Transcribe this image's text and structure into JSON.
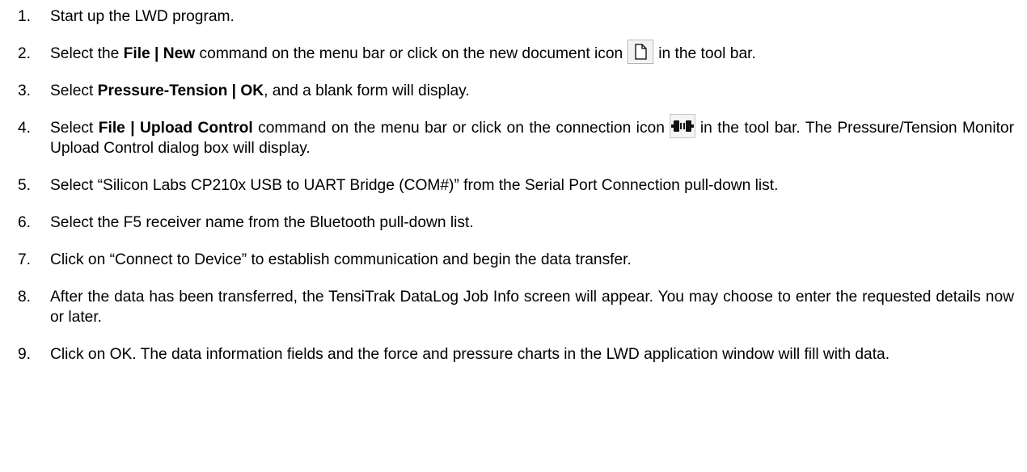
{
  "steps": [
    {
      "num": "1.",
      "parts": [
        {
          "t": "Start up the LWD program."
        }
      ]
    },
    {
      "num": "2.",
      "parts": [
        {
          "t": "Select the "
        },
        {
          "t": "File | New",
          "b": true
        },
        {
          "t": " command on the menu bar or click on the new document icon"
        },
        {
          "icon": "new-document-icon"
        },
        {
          "t": "in the tool bar."
        }
      ]
    },
    {
      "num": "3.",
      "parts": [
        {
          "t": "Select "
        },
        {
          "t": "Pressure-Tension | OK",
          "b": true
        },
        {
          "t": ", and a blank form will display."
        }
      ]
    },
    {
      "num": "4.",
      "parts": [
        {
          "t": "Select "
        },
        {
          "t": "File | Upload Control",
          "b": true
        },
        {
          "t": " command on the menu bar or click on the connection icon"
        },
        {
          "icon": "connection-icon"
        },
        {
          "t": "in the tool bar. The Pressure/Tension Monitor Upload Control dialog box will display."
        }
      ]
    },
    {
      "num": "5.",
      "parts": [
        {
          "t": "Select “Silicon Labs CP210x USB to UART Bridge (COM#)” from the Serial Port Connection pull-down list."
        }
      ]
    },
    {
      "num": "6.",
      "parts": [
        {
          "t": "Select the F5 receiver name from the Bluetooth pull-down list."
        }
      ]
    },
    {
      "num": "7.",
      "parts": [
        {
          "t": "Click on “Connect to Device” to establish communication and begin the data transfer."
        }
      ]
    },
    {
      "num": "8.",
      "parts": [
        {
          "t": "After the data has been transferred, the TensiTrak DataLog Job Info screen will appear. You may choose to enter the requested details now or later."
        }
      ]
    },
    {
      "num": "9.",
      "parts": [
        {
          "t": "Click on OK. The data information fields and the force and pressure charts in the LWD application window will fill with data."
        }
      ]
    }
  ]
}
